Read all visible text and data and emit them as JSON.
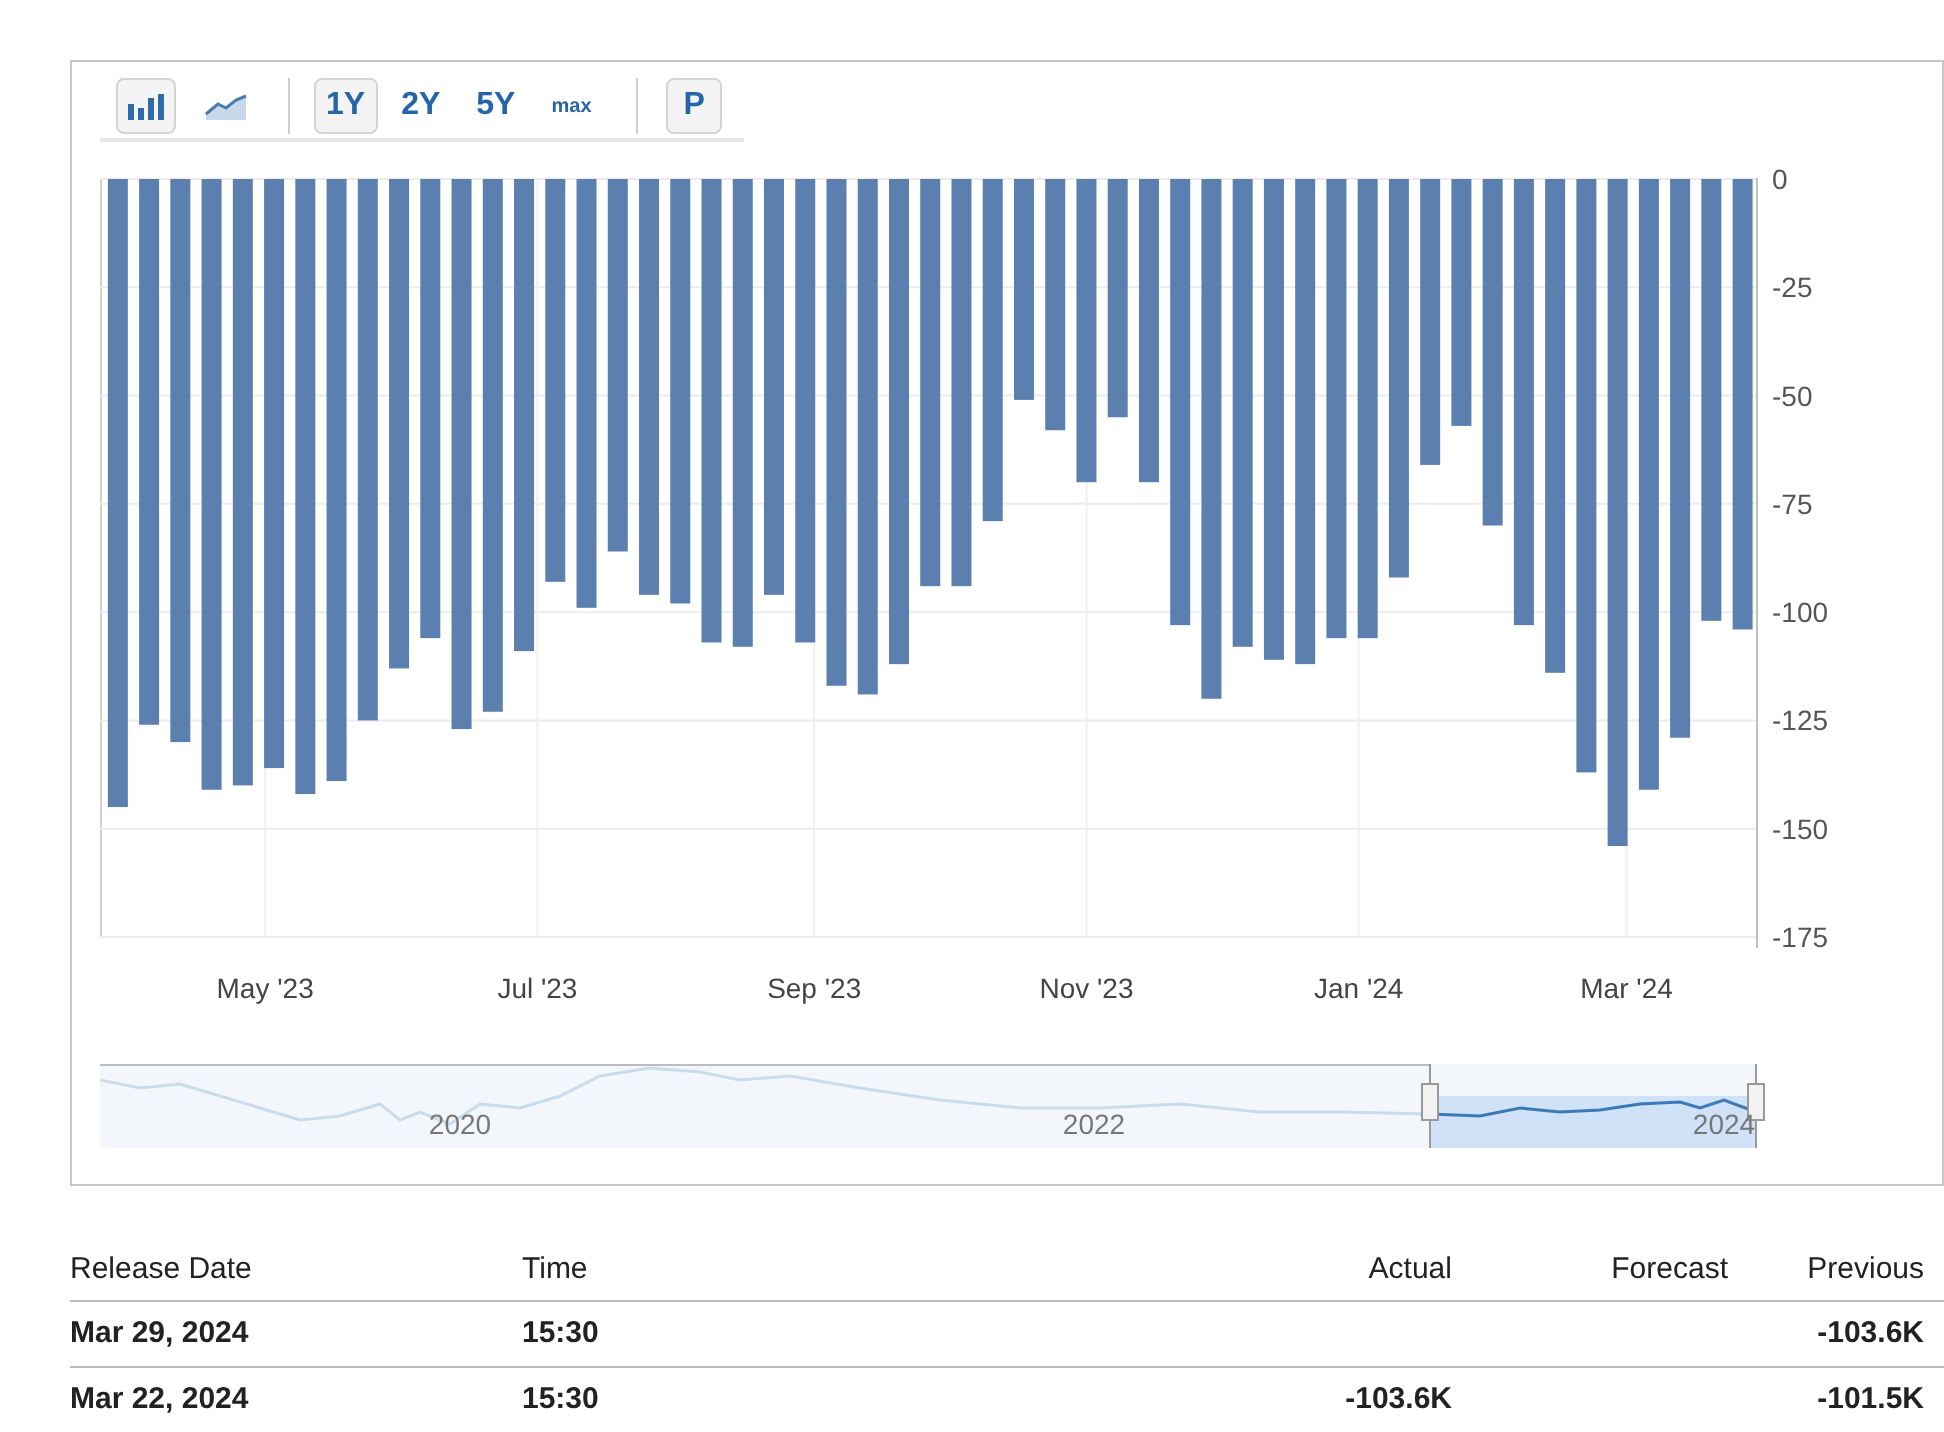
{
  "toolbar": {
    "chart_types": [
      {
        "kind": "bar",
        "selected": true
      },
      {
        "kind": "area",
        "selected": false
      }
    ],
    "ranges": [
      {
        "label": "1Y",
        "selected": true
      },
      {
        "label": "2Y",
        "selected": false
      },
      {
        "label": "5Y",
        "selected": false
      },
      {
        "label": "max",
        "selected": false
      }
    ],
    "extra_button": "P"
  },
  "chart": {
    "chart_data": {
      "type": "bar",
      "x": [
        "2023-03-29",
        "2023-04-05",
        "2023-04-12",
        "2023-04-19",
        "2023-04-26",
        "2023-05-03",
        "2023-05-10",
        "2023-05-17",
        "2023-05-24",
        "2023-05-31",
        "2023-06-07",
        "2023-06-14",
        "2023-06-21",
        "2023-06-28",
        "2023-07-05",
        "2023-07-12",
        "2023-07-19",
        "2023-07-26",
        "2023-08-02",
        "2023-08-09",
        "2023-08-16",
        "2023-08-23",
        "2023-08-30",
        "2023-09-06",
        "2023-09-13",
        "2023-09-20",
        "2023-09-27",
        "2023-10-04",
        "2023-10-11",
        "2023-10-18",
        "2023-10-25",
        "2023-11-01",
        "2023-11-08",
        "2023-11-15",
        "2023-11-22",
        "2023-11-29",
        "2023-12-06",
        "2023-12-13",
        "2023-12-20",
        "2023-12-27",
        "2024-01-03",
        "2024-01-10",
        "2024-01-17",
        "2024-01-24",
        "2024-01-31",
        "2024-02-07",
        "2024-02-14",
        "2024-02-21",
        "2024-02-28",
        "2024-03-06",
        "2024-03-13",
        "2024-03-20",
        "2024-03-27"
      ],
      "series": [
        {
          "color": "#5b7fae",
          "values": [
            -145,
            -126,
            -130,
            -141,
            -140,
            -136,
            -142,
            -139,
            -125,
            -113,
            -106,
            -127,
            -123,
            -109,
            -93,
            -99,
            -86,
            -96,
            -98,
            -107,
            -108,
            -96,
            -107,
            -117,
            -119,
            -112,
            -94,
            -94,
            -79,
            -51,
            -58,
            -70,
            -55,
            -70,
            -103,
            -120,
            -108,
            -111,
            -112,
            -106,
            -106,
            -92,
            -66,
            -57,
            -80,
            -103,
            -114,
            -137,
            -154,
            -141,
            -129,
            -102,
            -104
          ]
        }
      ],
      "xlim": [
        "2023-03-25",
        "2024-03-30"
      ],
      "grid": true,
      "ylim": [
        -175,
        0
      ],
      "yticks": [
        0,
        -25,
        -50,
        -75,
        -100,
        -125,
        -150,
        -175
      ],
      "xticks": [
        {
          "value": "2023-05-01",
          "label": "May '23"
        },
        {
          "value": "2023-07-01",
          "label": "Jul '23"
        },
        {
          "value": "2023-09-01",
          "label": "Sep '23"
        },
        {
          "value": "2023-11-01",
          "label": "Nov '23"
        },
        {
          "value": "2024-01-01",
          "label": "Jan '24"
        },
        {
          "value": "2024-03-01",
          "label": "Mar '24"
        }
      ]
    }
  },
  "navigator": {
    "labels": [
      "2020",
      "2022",
      "2024"
    ]
  },
  "table": {
    "columns": [
      "Release Date",
      "Time",
      "Actual",
      "Forecast",
      "Previous"
    ],
    "rows": [
      [
        "Mar 29, 2024",
        "15:30",
        "",
        "",
        "-103.6K"
      ],
      [
        "Mar 22, 2024",
        "15:30",
        "-103.6K",
        "",
        "-101.5K"
      ]
    ]
  }
}
